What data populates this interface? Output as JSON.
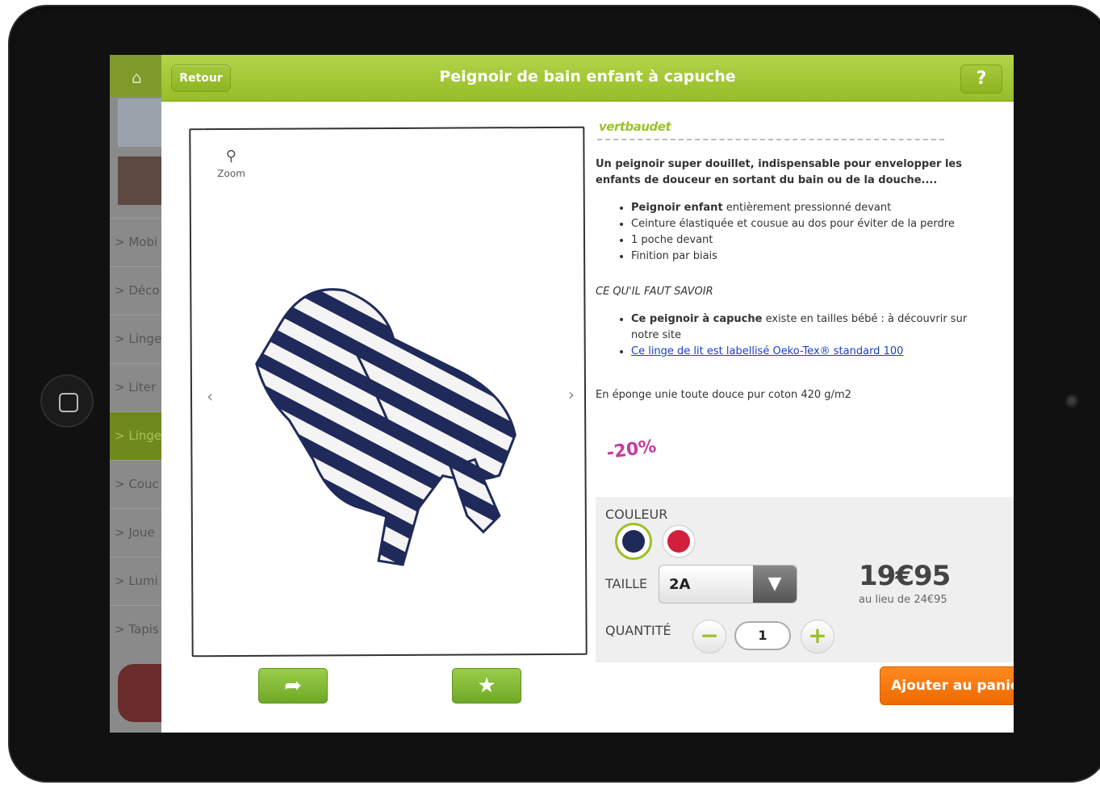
{
  "app": {
    "title": "Peignoir de bain enfant à capuche",
    "back_label": "Retour",
    "help_label": "?"
  },
  "sidebar": {
    "items": [
      {
        "label": "> Mobi"
      },
      {
        "label": "> Déco"
      },
      {
        "label": "> Linge"
      },
      {
        "label": "> Liter"
      },
      {
        "label": "> Linge"
      },
      {
        "label": "> Couc"
      },
      {
        "label": "> Joue"
      },
      {
        "label": "> Lumi"
      },
      {
        "label": "> Tapis"
      }
    ],
    "active_index": 4
  },
  "product": {
    "brand": "vertbaudet",
    "zoom_label": "Zoom",
    "intro": "Un peignoir super douillet, indispensable pour envelopper les enfants de douceur en sortant du bain ou de la douche....",
    "features": [
      {
        "bold": "Peignoir enfant",
        "text": " entièrement pressionné devant"
      },
      {
        "bold": "",
        "text": "Ceinture élastiquée et cousue au dos pour éviter de la perdre"
      },
      {
        "bold": "",
        "text": "1 poche devant"
      },
      {
        "bold": "",
        "text": "Finition par biais"
      }
    ],
    "section_title": "CE QU'IL FAUT SAVOIR",
    "info": [
      {
        "bold": "Ce peignoir à capuche",
        "text": " existe en tailles bébé : à découvrir sur notre site"
      }
    ],
    "info_link": "Ce linge de lit est labellisé Oeko-Tex® standard 100",
    "fabric": "En éponge unie toute douce pur coton 420 g/m2",
    "promo": "-20%",
    "colors": [
      "#1f2a5a",
      "#d21f3c"
    ]
  },
  "purchase": {
    "color_label": "COULEUR",
    "size_label": "TAILLE",
    "size_value": "2A",
    "quantity_label": "QUANTITÉ",
    "quantity": "1",
    "price": "19€95",
    "old_price": "au lieu de 24€95",
    "cart_label": "Ajouter au panier"
  }
}
